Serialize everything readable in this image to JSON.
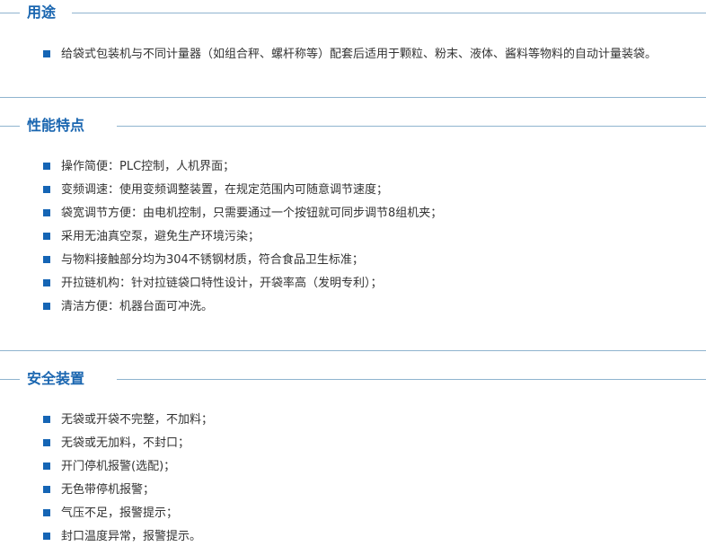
{
  "colors": {
    "title": "#1a66b0",
    "bullet": "#1565b5",
    "rule": "#8fb4cf",
    "text": "#333333"
  },
  "sections": [
    {
      "title": "用途",
      "items": [
        "给袋式包装机与不同计量器（如组合秤、螺杆称等）配套后适用于颗粒、粉末、液体、酱料等物料的自动计量装袋。"
      ]
    },
    {
      "title": "性能特点",
      "items": [
        "操作简便：PLC控制，人机界面；",
        "变频调速：使用变频调整装置，在规定范围内可随意调节速度；",
        "袋宽调节方便：由电机控制，只需要通过一个按钮就可同步调节8组机夹；",
        "采用无油真空泵，避免生产环境污染；",
        "与物料接触部分均为304不锈钢材质，符合食品卫生标准；",
        "开拉链机构：针对拉链袋口特性设计，开袋率高（发明专利）；",
        "清洁方便：机器台面可冲洗。"
      ]
    },
    {
      "title": "安全装置",
      "items": [
        "无袋或开袋不完整，不加料；",
        "无袋或无加料，不封口；",
        "开门停机报警(选配)；",
        "无色带停机报警；",
        "气压不足，报警提示；",
        "封口温度异常，报警提示。"
      ]
    }
  ]
}
